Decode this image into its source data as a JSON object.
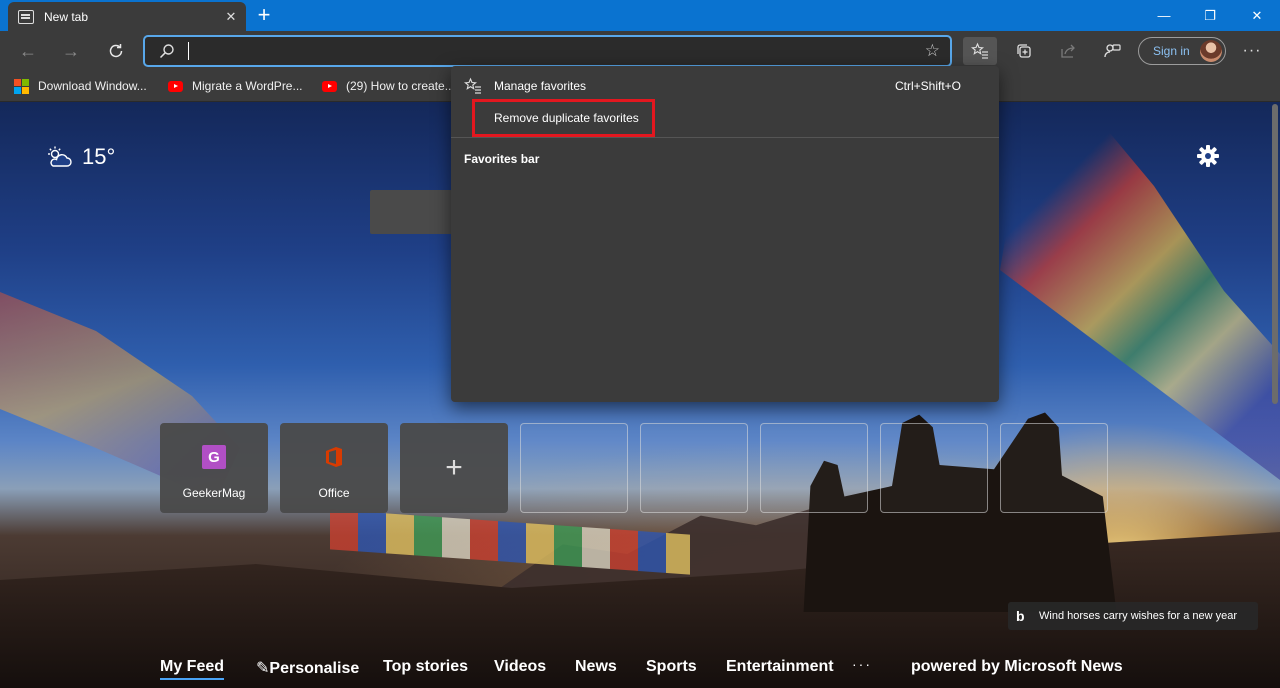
{
  "tab": {
    "title": "New tab"
  },
  "window_controls": {
    "minimize": "—",
    "restore": "❐",
    "close": "✕"
  },
  "omnibox": {
    "value": "",
    "placeholder": ""
  },
  "toolbar": {
    "signin_label": "Sign in"
  },
  "favorites_bar": [
    {
      "label": "Download Window...",
      "icon": "microsoft-logo"
    },
    {
      "label": "Migrate a WordPre...",
      "icon": "youtube-logo"
    },
    {
      "label": "(29) How to create...",
      "icon": "youtube-logo"
    }
  ],
  "weather": {
    "temp": "15°",
    "icon": "partly-cloudy-icon"
  },
  "quick_links": [
    {
      "label": "GeekerMag",
      "letter": "G",
      "color": "#b14fc5"
    },
    {
      "label": "Office",
      "icon": "office-logo",
      "color": "#d83b01"
    }
  ],
  "image_caption": "Wind horses carry wishes for a new year",
  "feed_nav": {
    "items": [
      "My Feed",
      "Personalise",
      "Top stories",
      "Videos",
      "News",
      "Sports",
      "Entertainment"
    ],
    "more": "···",
    "powered_by": "powered by Microsoft News"
  },
  "favorites_menu": {
    "manage_label": "Manage favorites",
    "manage_shortcut": "Ctrl+Shift+O",
    "remove_duplicates_label": "Remove duplicate favorites",
    "section_heading": "Favorites bar",
    "highlight_color": "#e3171f"
  }
}
